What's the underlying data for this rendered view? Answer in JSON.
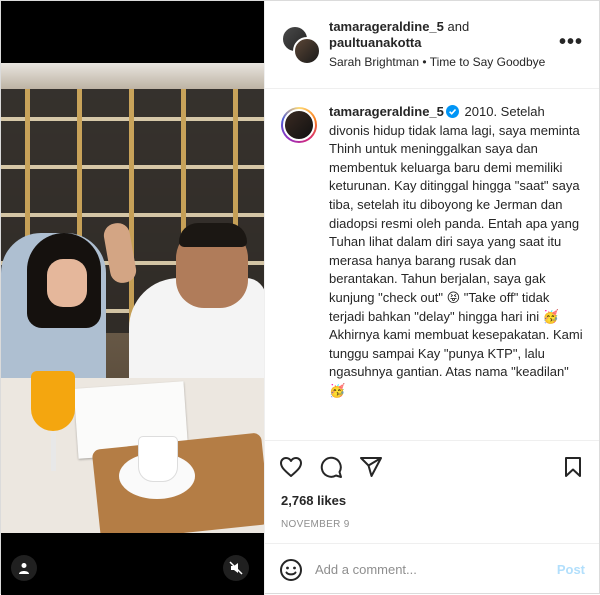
{
  "header": {
    "user1": "tamarageraldine_5",
    "joiner": " and",
    "user2": "paultuanakotta",
    "audio": "Sarah Brightman • Time to Say Goodbye",
    "more_label": "•••"
  },
  "caption": {
    "username": "tamarageraldine_5",
    "text": " 2010. Setelah divonis hidup tidak lama lagi, saya meminta Thinh untuk meninggalkan saya dan membentuk keluarga baru demi memiliki keturunan. Kay ditinggal hingga \"saat\" saya tiba, setelah itu diboyong ke Jerman dan diadopsi resmi oleh panda. Entah apa yang Tuhan lihat dalam diri saya yang saat itu merasa hanya barang rusak dan berantakan. Tahun berjalan, saya gak kunjung \"check out\" 😝 \"Take off\" tidak terjadi bahkan \"delay\" hingga hari ini 🥳 Akhirnya kami membuat kesepakatan. Kami tunggu sampai Kay \"punya KTP\", lalu ngasuhnya gantian. Atas nama \"keadilan\" 🥳"
  },
  "stats": {
    "likes": "2,768 likes",
    "date": "NOVEMBER 9"
  },
  "comment": {
    "placeholder": "Add a comment...",
    "post_label": "Post"
  },
  "icons": {
    "more": "more-options-icon",
    "like": "heart-icon",
    "comment": "comment-icon",
    "share": "share-icon",
    "save": "bookmark-icon",
    "emoji": "emoji-icon",
    "user_tag": "user-tag-icon",
    "mute": "mute-icon",
    "verified": "verified-badge-icon"
  },
  "colors": {
    "post_button": "#b2dffc",
    "verified": "#0095f6",
    "date": "#8e8e8e"
  }
}
